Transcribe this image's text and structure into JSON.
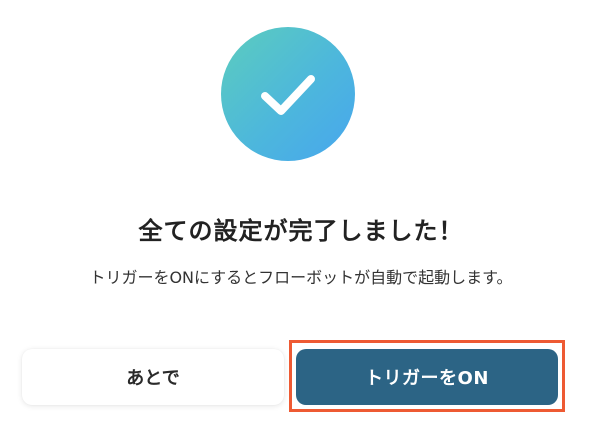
{
  "dialog": {
    "icon": "check-icon",
    "title": "全ての設定が完了しました！",
    "description": "トリガーをONにするとフローボットが自動で起動します。",
    "buttons": {
      "later_label": "あとで",
      "trigger_on_label": "トリガーをON"
    },
    "colors": {
      "badge_gradient_start": "#5ccdbd",
      "badge_gradient_end": "#47a6ee",
      "primary_button": "#2c6485",
      "highlight_border": "#ee5a33"
    }
  }
}
